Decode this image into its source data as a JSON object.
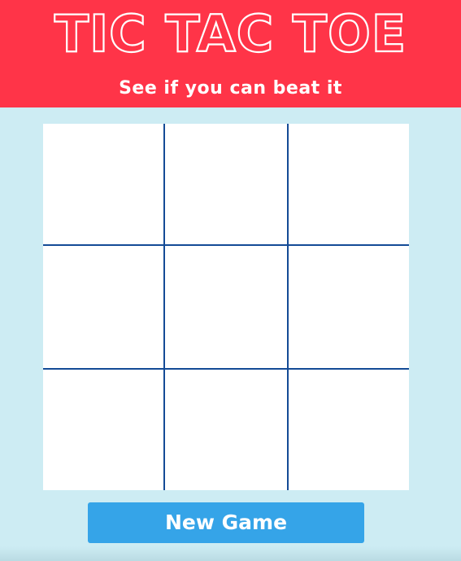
{
  "header": {
    "title": "TIC TAC TOE",
    "subtitle": "See if you can beat it"
  },
  "board": {
    "rows": 3,
    "columns": 3,
    "cells": [
      "",
      "",
      "",
      "",
      "",
      "",
      "",
      "",
      ""
    ]
  },
  "controls": {
    "new_game_label": "New Game"
  },
  "colors": {
    "header_background": "#ff3448",
    "page_background": "#cdecf3",
    "grid_lines": "#144b96",
    "cell_background": "#ffffff",
    "button_background": "#35a4e8",
    "button_text": "#ffffff"
  }
}
